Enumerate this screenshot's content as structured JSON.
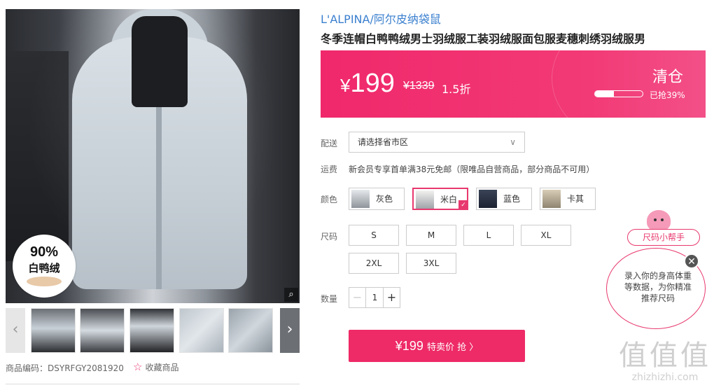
{
  "gallery": {
    "badge_percent": "90%",
    "badge_label": "白鸭绒",
    "zoom_icon": "magnifier-icon",
    "prev_icon": "chevron-left-icon",
    "next_icon": "chevron-right-icon",
    "thumb_count": 5
  },
  "product_code": {
    "label": "商品编码：",
    "value": "DSYRFGY2081920"
  },
  "favorite": {
    "icon": "star-outline-icon",
    "label": "收藏商品"
  },
  "brand": "L'ALPINA/阿尔皮纳袋鼠",
  "title": "冬季连帽白鸭鸭绒男士羽绒服工装羽绒服面包服麦穗刺绣羽绒服男",
  "price_box": {
    "symbol": "¥",
    "price": "199",
    "original": "¥1339",
    "discount": "1.5折",
    "tag": "清仓",
    "progress_fraction": 0.39,
    "progress_text": "已抢39%",
    "bg_color": "#f0286b"
  },
  "delivery": {
    "label": "配送",
    "placeholder": "请选择省市区"
  },
  "shipping": {
    "label": "运费",
    "text": "新会员专享首单满38元免邮（限唯品自营商品，部分商品不可用）"
  },
  "color": {
    "label": "颜色",
    "options": [
      {
        "name": "灰色",
        "selected": false
      },
      {
        "name": "米白",
        "selected": true
      },
      {
        "name": "蓝色",
        "selected": false
      },
      {
        "name": "卡其",
        "selected": false
      }
    ]
  },
  "size": {
    "label": "尺码",
    "options": [
      "S",
      "M",
      "L",
      "XL",
      "2XL",
      "3XL"
    ]
  },
  "quantity": {
    "label": "数量",
    "minus": "−",
    "value": "1",
    "plus": "+"
  },
  "buy": {
    "price": "¥199",
    "label": "特卖价 抢 〉"
  },
  "size_helper": {
    "title": "尺码小帮手",
    "text": "录入你的身高体重等数据，为你精准推荐尺码",
    "close_icon": "close-icon"
  },
  "watermark": {
    "chars": "值值值",
    "domain": "zhizhizhi.com"
  }
}
